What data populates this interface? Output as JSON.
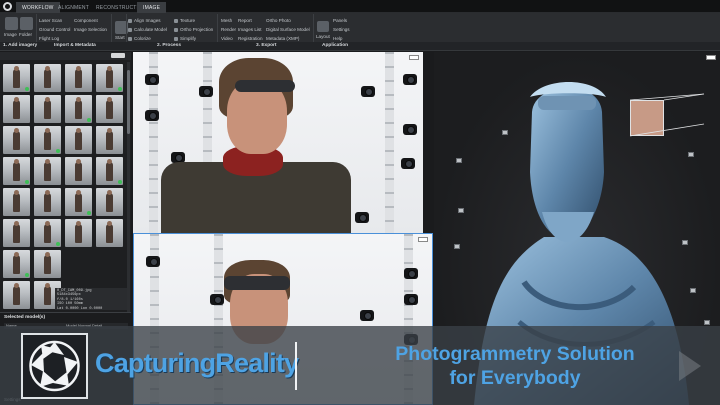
{
  "tabs": [
    {
      "label": "WORKFLOW",
      "active": true
    },
    {
      "label": "ALIGNMENT",
      "active": false
    },
    {
      "label": "RECONSTRUCTION",
      "active": false
    },
    {
      "label": "IMAGE",
      "active": false
    }
  ],
  "ribbon": {
    "add_imagery": {
      "image_label": "Image",
      "folder_label": "Folder",
      "laser_scan": "Laser Scan",
      "component": "Component",
      "ground_control": "Ground Control",
      "image_selection": "Image Selection",
      "flight_log": "Flight Log"
    },
    "start_label": "Start",
    "process": {
      "align_images": "Align Images",
      "calculate_model": "Calculate Model",
      "colorize": "Colorize",
      "texture": "Texture",
      "ortho_projection": "Ortho Projection",
      "simplify": "Simplify"
    },
    "export": {
      "mesh": "Mesh",
      "render": "Render",
      "video": "Video",
      "report": "Report",
      "images_list": "Images List",
      "registration": "Registration",
      "ortho_photo": "Ortho Photo",
      "digital_surface_model": "Digital Surface Model",
      "metadata_xmp": "Metadata (XMP)"
    },
    "application": {
      "layout": "Layout",
      "panels": "Panels",
      "settings": "Settings",
      "help": "Help"
    },
    "groups": [
      "1. Add imagery",
      "Import & Metadata",
      "2. Process",
      "3. Export",
      "Application"
    ]
  },
  "left_panel": {
    "header_chip": "105",
    "meta_lines": [
      "0_DT_CAM_009.jpg",
      "5184x3456px",
      "f/8.0  1/160s",
      "ISO 100  50mm",
      "Lat  0.0000  Lon 0.0000"
    ],
    "selected_title": "Selected model(s)",
    "columns": [
      "Name",
      "Model Normal Detail"
    ],
    "settings_label": "Settings"
  },
  "overlay": {
    "brand_name": "CapturingReality",
    "tagline_line1": "Photogrammetry Solution",
    "tagline_line2": "for Everybody"
  },
  "colors": {
    "accent": "#4ea3e4",
    "app_bg": "#1a1b1d",
    "ribbon": "#2b2d30",
    "selection_border": "#4a90d9"
  },
  "icons": {
    "app_logo": "app-logo-icon",
    "brand_logo": "capturing-reality-aperture-logo"
  }
}
